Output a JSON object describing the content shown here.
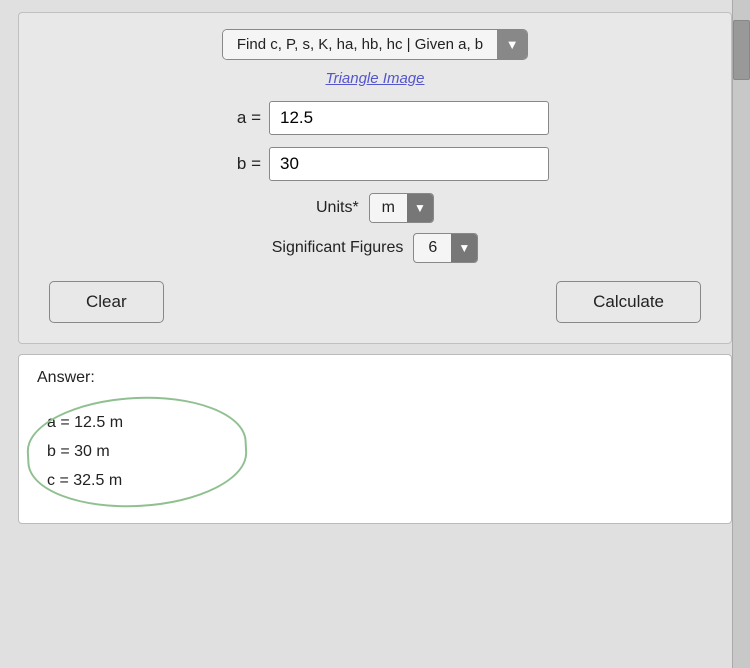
{
  "header": {
    "formula_label": "Find c, P, s, K, ha, hb, hc | Given a, b",
    "triangle_link": "Triangle Image"
  },
  "inputs": {
    "a_label": "a =",
    "a_value": "12.5",
    "b_label": "b =",
    "b_value": "30"
  },
  "units": {
    "label": "Units*",
    "value": "m"
  },
  "sig_figs": {
    "label": "Significant Figures",
    "value": "6"
  },
  "buttons": {
    "clear_label": "Clear",
    "calculate_label": "Calculate"
  },
  "answer": {
    "title": "Answer:",
    "lines": [
      "a = 12.5 m",
      "b = 30 m",
      "c = 32.5 m"
    ]
  },
  "icons": {
    "dropdown_arrow": "▼"
  }
}
